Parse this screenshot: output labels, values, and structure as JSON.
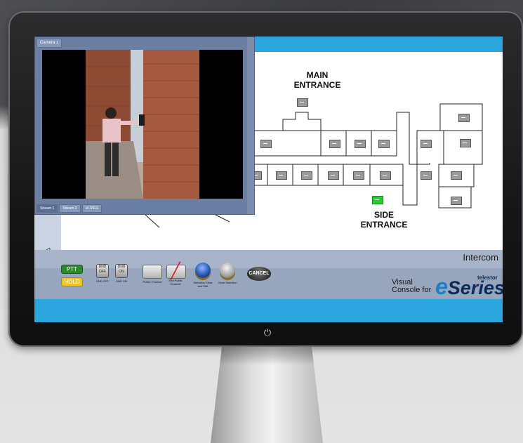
{
  "screen": {
    "camera_window": {
      "title": "Camera 1",
      "tabs": [
        "Stream 1",
        "Stream 2",
        "M JPEG"
      ]
    },
    "map": {
      "main_entrance_label": "MAIN\nENTRANCE",
      "side_entrance_label": "SIDE\nENTRANCE"
    },
    "status": {
      "mode": "Intercom"
    },
    "controls": {
      "ptt": "PTT",
      "hold": "HOLD",
      "dnd_off_icon": "DND OFF",
      "dnd_on_icon": "DND ON",
      "dnd_off": "DND OFF",
      "dnd_on": "DND ON",
      "public_channel": "Public Channel",
      "end_public_channel": "End Public Channel",
      "selection_clear_edit": "Selection Clear and Edit",
      "clear_selection": "Clear Selection",
      "cancel": "CANCEL"
    },
    "brand": {
      "visual_console": "Visual\nConsole for",
      "eseries_e": "e",
      "eseries_rest": "Series",
      "maker": "telestor"
    }
  },
  "monitor": {
    "power_icon": "power-icon"
  }
}
